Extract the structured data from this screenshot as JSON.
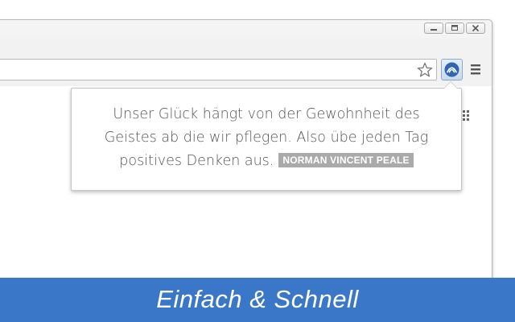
{
  "popup": {
    "quote_line1": "Unser Glück hängt von der Gewohnheit des",
    "quote_line2": "Geistes ab die wir pflegen. Also übe jeden Tag",
    "quote_line3": "positives Denken aus.",
    "author": "NORMAN VINCENT PEALE"
  },
  "banner": {
    "text": "Einfach & Schnell"
  },
  "icons": {
    "bookmark": "star-icon",
    "extension": "extension-logo-icon",
    "menu": "hamburger-menu-icon",
    "apps": "apps-grid-icon"
  },
  "colors": {
    "banner": "#3b77c8",
    "author_badge": "#aaaaaa",
    "quote_text": "#555555",
    "extension_accent": "#2f66b3"
  }
}
